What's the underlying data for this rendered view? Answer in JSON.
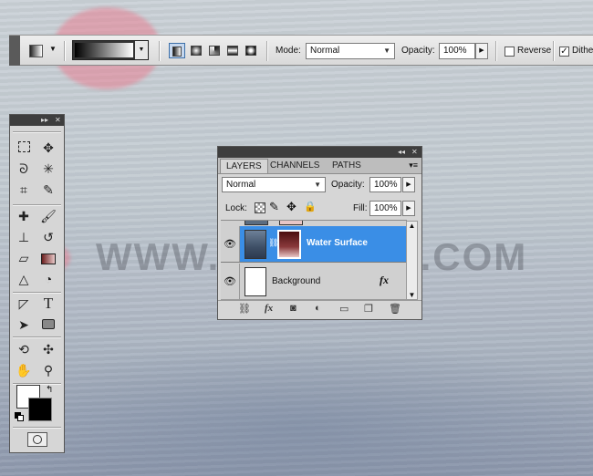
{
  "watermark": "WWW.PSDDUDE.COM",
  "options_bar": {
    "mode_label": "Mode:",
    "mode_value": "Normal",
    "opacity_label": "Opacity:",
    "opacity_value": "100%",
    "reverse_label": "Reverse",
    "reverse_checked": false,
    "dither_label": "Dithe",
    "dither_checked": true,
    "gradient_types": [
      "linear",
      "radial",
      "angle",
      "reflected",
      "diamond"
    ],
    "active_gradient_type": "linear"
  },
  "tools": [
    "marquee-tool",
    "move-tool",
    "lasso-tool",
    "magic-wand-tool",
    "crop-tool",
    "eyedropper-tool",
    "healing-brush-tool",
    "brush-tool",
    "clone-stamp-tool",
    "history-brush-tool",
    "eraser-tool",
    "gradient-tool",
    "blur-tool",
    "dodge-tool",
    "pen-tool",
    "type-tool",
    "path-selection-tool",
    "shape-tool",
    "3d-rotate-tool",
    "3d-orbit-tool",
    "hand-tool",
    "zoom-tool"
  ],
  "layers_panel": {
    "tabs": [
      "LAYERS",
      "CHANNELS",
      "PATHS"
    ],
    "active_tab": "LAYERS",
    "blend_mode": "Normal",
    "opacity_label": "Opacity:",
    "opacity_value": "100%",
    "lock_label": "Lock:",
    "fill_label": "Fill:",
    "fill_value": "100%",
    "layers": [
      {
        "name": "Water Surface",
        "selected": true,
        "visible": true
      },
      {
        "name": "Background",
        "selected": false,
        "visible": true
      }
    ]
  },
  "colors": {
    "selection": "#3a8ee6",
    "highlight": "#eb788c",
    "panel_bg": "#d6d6d6"
  }
}
